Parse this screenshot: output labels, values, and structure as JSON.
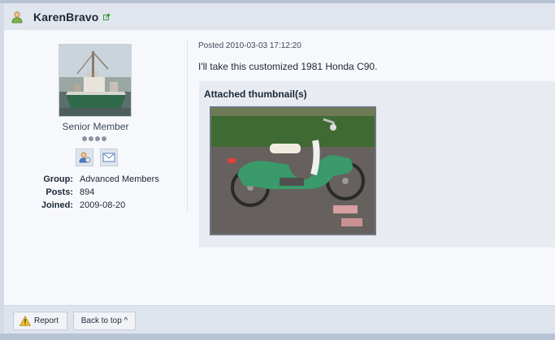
{
  "header": {
    "username": "KarenBravo",
    "user_icon": "user-icon",
    "ext_icon": "external-link-icon"
  },
  "profile": {
    "rank": "Senior Member",
    "pips": 4,
    "icons": [
      "user-profile-icon",
      "envelope-icon"
    ],
    "fields": [
      {
        "label": "Group:",
        "value": "Advanced Members"
      },
      {
        "label": "Posts:",
        "value": "894"
      },
      {
        "label": "Joined:",
        "value": "2009-08-20"
      }
    ]
  },
  "post": {
    "posted": "Posted 2010-03-03 17:12:20",
    "text": "I'll take this customized 1981 Honda C90.",
    "attach_title": "Attached thumbnail(s)"
  },
  "footer": {
    "report_label": "Report",
    "back_to_top_label": "Back to top ^"
  },
  "colors": {
    "header_bg": "#e1e6ee",
    "panel_bg": "#f7f8fb",
    "accent": "#b7c3d4"
  }
}
